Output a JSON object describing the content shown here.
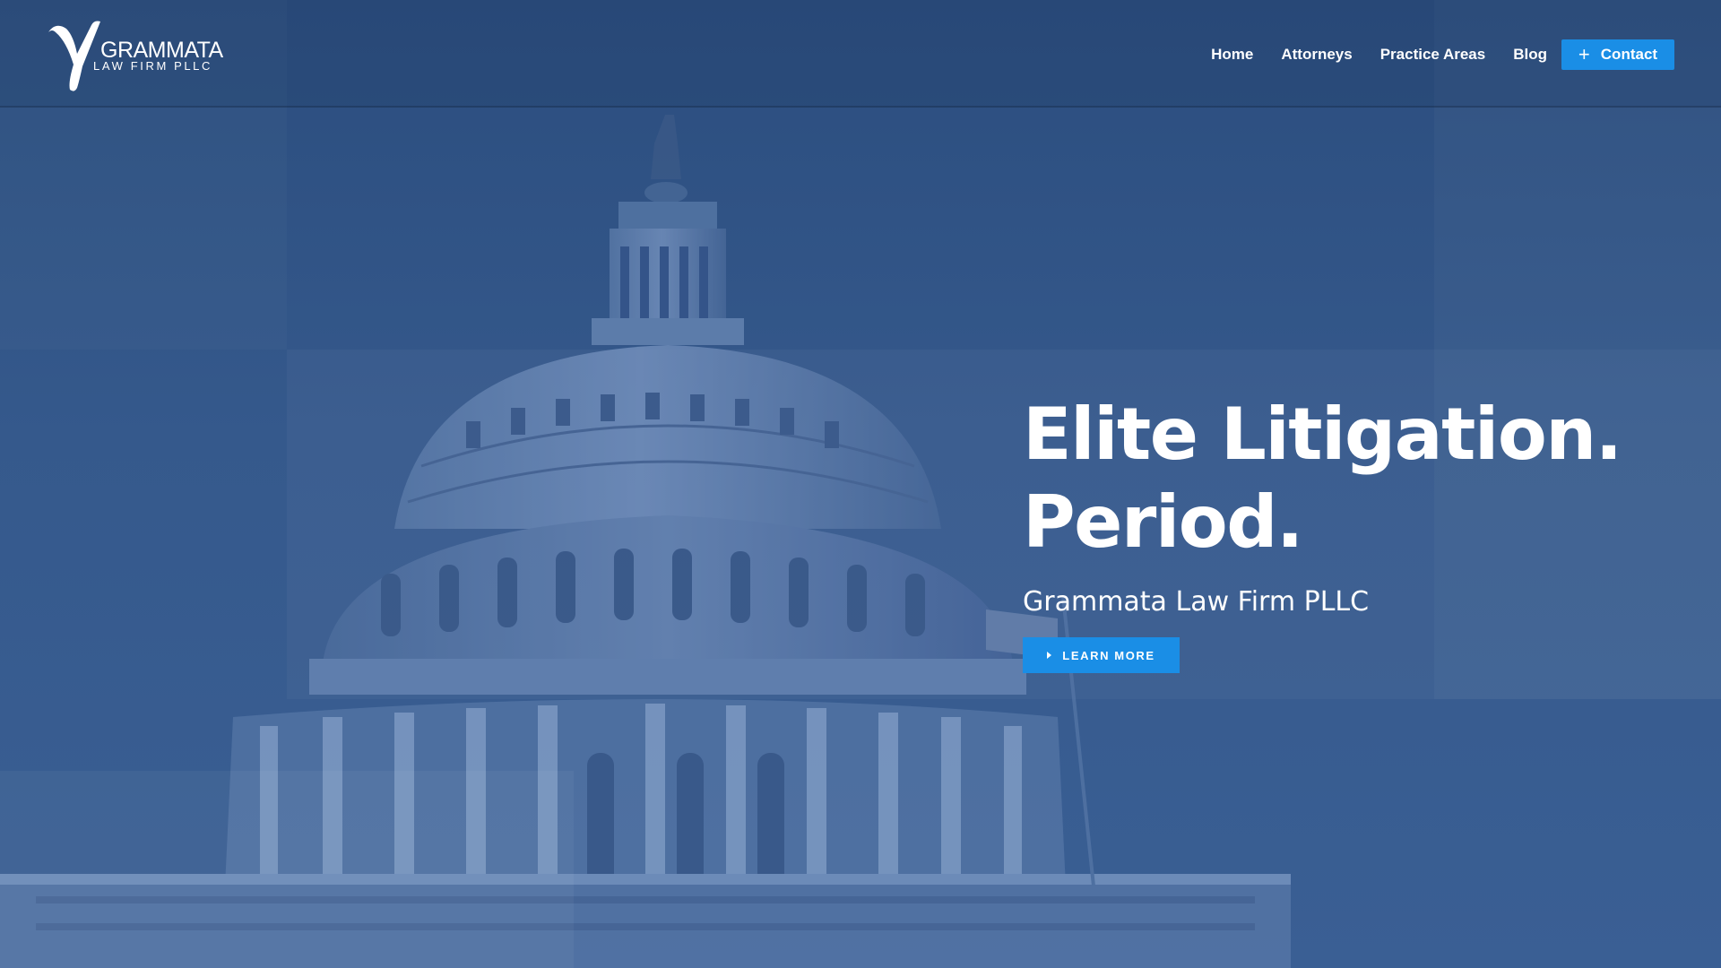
{
  "brand": {
    "logo_symbol": "Y",
    "name": "GRAMMATA",
    "tagline": "LAW FIRM PLLC"
  },
  "nav": {
    "items": [
      {
        "label": "Home"
      },
      {
        "label": "Attorneys"
      },
      {
        "label": "Practice Areas"
      },
      {
        "label": "Blog"
      }
    ],
    "contact": {
      "icon": "plus-icon",
      "label": "Contact"
    }
  },
  "hero": {
    "headline_line1": "Elite Litigation.",
    "headline_line2": "Period.",
    "subtitle": "Grammata Law Firm PLLC",
    "cta": {
      "icon": "caret-right-icon",
      "label": "LEARN MORE"
    },
    "background_image": "us-capitol-dome"
  },
  "colors": {
    "overlay": "#2c4f80",
    "accent": "#1a8ee6",
    "text": "#ffffff"
  }
}
